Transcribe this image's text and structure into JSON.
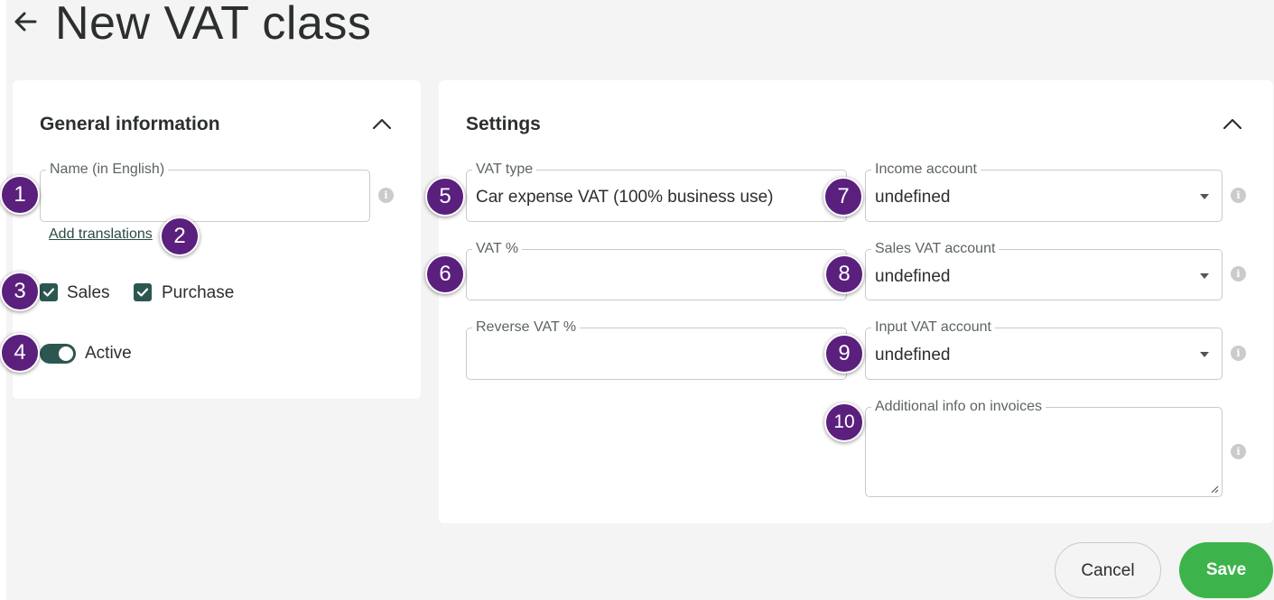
{
  "header": {
    "title": "New VAT class"
  },
  "general": {
    "title": "General information",
    "name_label": "Name (in English)",
    "name_value": "",
    "add_translations": "Add translations",
    "sales_label": "Sales",
    "sales_checked": true,
    "purchase_label": "Purchase",
    "purchase_checked": true,
    "active_label": "Active",
    "active_on": true
  },
  "settings": {
    "title": "Settings",
    "vat_type_label": "VAT type",
    "vat_type_value": "Car expense VAT (100% business use)",
    "vat_pct_label": "VAT %",
    "vat_pct_value": "",
    "reverse_vat_label": "Reverse VAT %",
    "reverse_vat_value": "",
    "income_account_label": "Income account",
    "income_account_value": "undefined",
    "sales_vat_account_label": "Sales VAT account",
    "sales_vat_account_value": "undefined",
    "input_vat_account_label": "Input VAT account",
    "input_vat_account_value": "undefined",
    "additional_info_label": "Additional info on invoices",
    "additional_info_value": ""
  },
  "annotations": [
    "1",
    "2",
    "3",
    "4",
    "5",
    "6",
    "7",
    "8",
    "9",
    "10"
  ],
  "actions": {
    "cancel": "Cancel",
    "save": "Save"
  },
  "colors": {
    "accent_dark_green": "#2c5751",
    "save_green": "#3cb44b",
    "badge_purple": "#5b1f7d",
    "page_background": "#f3f4f3"
  },
  "icons": {
    "back": "arrow-left-icon",
    "collapse": "chevron-up-icon",
    "info": "info-icon",
    "dropdown": "caret-down-icon",
    "check": "check-icon"
  }
}
